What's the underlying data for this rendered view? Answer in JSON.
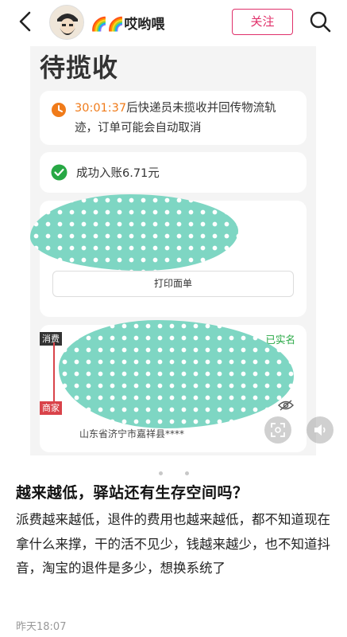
{
  "header": {
    "author_name": "🌈🌈哎哟喂",
    "follow_label": "关注"
  },
  "post_image": {
    "title": "待揽收",
    "notice": {
      "timer": "30:01:37",
      "text": "后快递员未揽收并回传物流轨迹，订单可能会自动取消"
    },
    "credited_text": "成功入账6.71元",
    "print_button_label": "打印面单",
    "verified_label": "已实名",
    "consumer_tag": "消费",
    "merchant_tag": "商家",
    "address": "山东省济宁市嘉祥县****"
  },
  "post": {
    "title": "越来越低，驿站还有生存空间吗？",
    "body": "派费越来越低，退件的费用也越来越低，都不知道现在拿什么来撑，干的活不见少，钱越来越少，也不知道抖音，淘宝的退件是多少，想换系统了",
    "time": "昨天18:07"
  },
  "carousel": {
    "page_count": 2
  },
  "colors": {
    "accent": "#e0306a",
    "timer": "#f07b1a",
    "success": "#27a844",
    "sticker": "#7ed6c3"
  },
  "icons": {
    "back": "back-arrow-icon",
    "search": "search-icon",
    "clock": "clock-icon",
    "check": "check-circle-icon",
    "eye": "eye-hidden-icon",
    "scan": "scan-icon",
    "speaker": "speaker-icon"
  }
}
